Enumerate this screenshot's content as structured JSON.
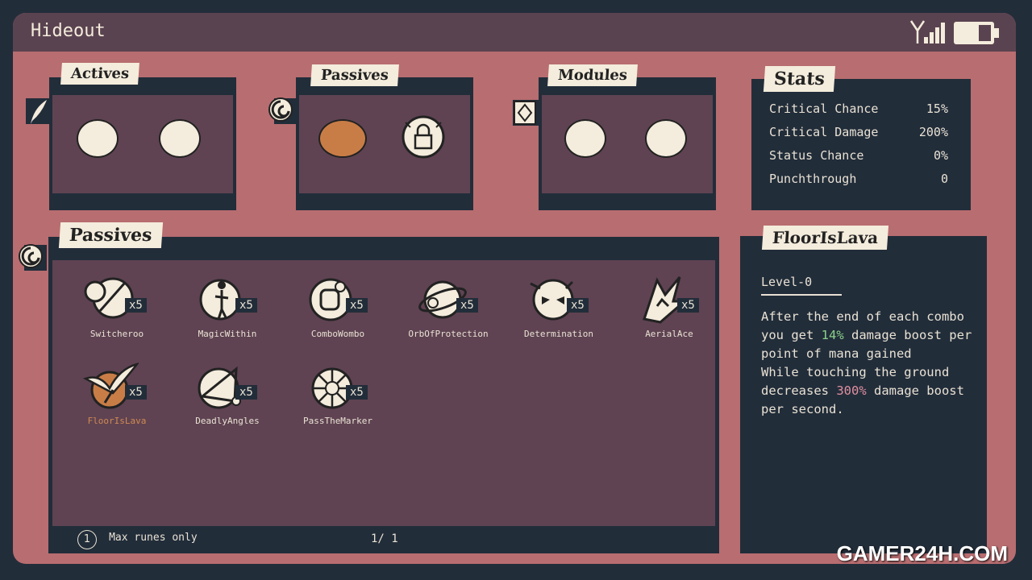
{
  "window": {
    "title": "Hideout"
  },
  "status_icons": [
    "signal-icon",
    "battery-icon"
  ],
  "actives": {
    "label": "Actives",
    "slots": [
      "empty",
      "empty"
    ]
  },
  "passives_slots": {
    "label": "Passives",
    "slots": [
      "filled",
      "locked"
    ]
  },
  "modules": {
    "label": "Modules",
    "slots": [
      "empty",
      "empty"
    ]
  },
  "stats": {
    "label": "Stats",
    "rows": [
      {
        "name": "Critical Chance",
        "value": "15%"
      },
      {
        "name": "Critical Damage",
        "value": "200%"
      },
      {
        "name": "Status Chance",
        "value": "0%"
      },
      {
        "name": "Punchthrough",
        "value": "0"
      }
    ]
  },
  "passives_list": {
    "label": "Passives",
    "runes": [
      {
        "name": "Switcheroo",
        "count": "x5",
        "icon": "switcheroo-icon"
      },
      {
        "name": "MagicWithin",
        "count": "x5",
        "icon": "magic-within-icon"
      },
      {
        "name": "ComboWombo",
        "count": "x5",
        "icon": "combo-wombo-icon"
      },
      {
        "name": "OrbOfProtection",
        "count": "x5",
        "icon": "orb-icon"
      },
      {
        "name": "Determination",
        "count": "x5",
        "icon": "determination-icon"
      },
      {
        "name": "AerialAce",
        "count": "x5",
        "icon": "aerial-ace-icon"
      },
      {
        "name": "FloorIsLava",
        "count": "x5",
        "icon": "floor-is-lava-icon",
        "selected": true
      },
      {
        "name": "DeadlyAngles",
        "count": "x5",
        "icon": "deadly-angles-icon"
      },
      {
        "name": "PassTheMarker",
        "count": "x5",
        "icon": "pass-the-marker-icon"
      }
    ],
    "footer": {
      "filter_key": "1",
      "filter_label": "Max runes only",
      "page": "1/ 1"
    }
  },
  "detail": {
    "title": "FloorIsLava",
    "level": "Level-0",
    "line1a": "After the end of each combo",
    "line2a": "you get ",
    "line2b": "14%",
    "line2c": " damage boost per",
    "line3": "point of mana gained",
    "line4": "While touching the ground",
    "line5a": "decreases ",
    "line5b": "300%",
    "line5c": " damage boost",
    "line6": "per second."
  },
  "watermark": "GAMER24H.COM"
}
